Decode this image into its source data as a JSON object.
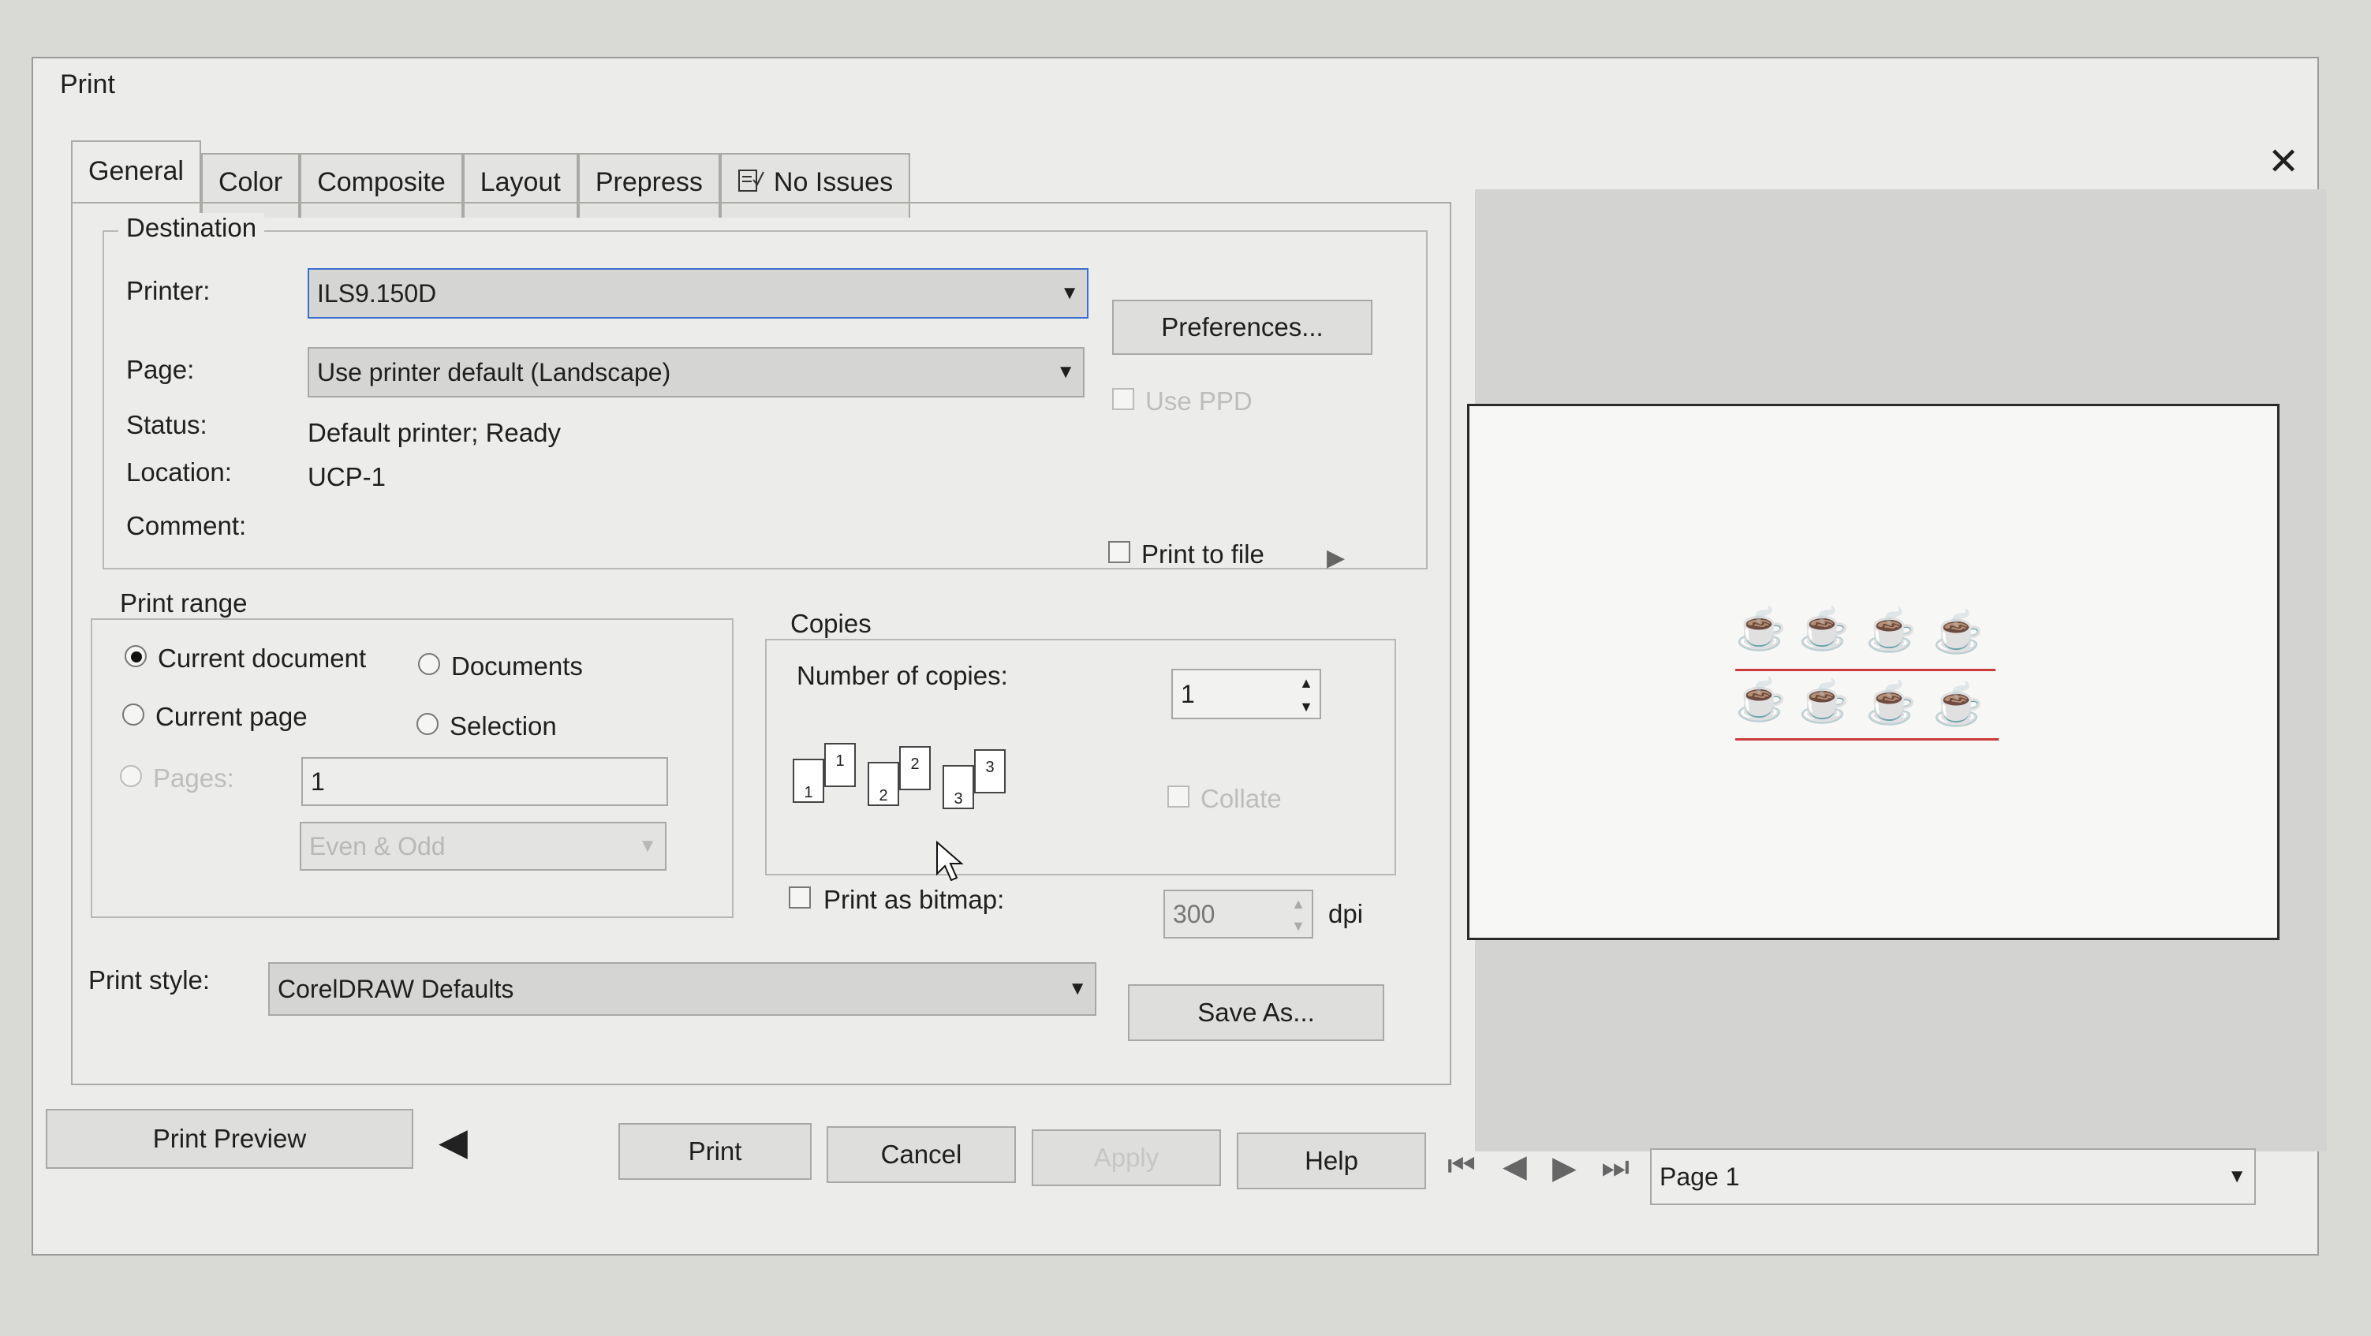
{
  "window": {
    "title": "Print"
  },
  "tabs": [
    {
      "label": "General",
      "active": true
    },
    {
      "label": "Color"
    },
    {
      "label": "Composite"
    },
    {
      "label": "Layout"
    },
    {
      "label": "Prepress"
    },
    {
      "label": "No Issues",
      "icon": "issues-icon"
    }
  ],
  "destination": {
    "legend": "Destination",
    "printer_label": "Printer:",
    "printer_value": "ILS9.150D",
    "preferences_button": "Preferences...",
    "page_label": "Page:",
    "page_value": "Use printer default (Landscape)",
    "use_ppd_label": "Use PPD",
    "status_label": "Status:",
    "status_value": "Default printer; Ready",
    "location_label": "Location:",
    "location_value": "UCP-1",
    "comment_label": "Comment:",
    "print_to_file_label": "Print to file"
  },
  "print_range": {
    "legend": "Print range",
    "current_document": "Current document",
    "documents": "Documents",
    "current_page": "Current page",
    "selection": "Selection",
    "pages_label": "Pages:",
    "pages_value": "1",
    "even_odd": "Even & Odd"
  },
  "copies": {
    "legend": "Copies",
    "number_label": "Number of copies:",
    "number_value": "1",
    "collate_label": "Collate",
    "collate_digits": [
      "1",
      "1",
      "2",
      "2",
      "3",
      "3"
    ]
  },
  "bitmap": {
    "label": "Print as bitmap:",
    "dpi_value": "300",
    "dpi_unit": "dpi"
  },
  "print_style": {
    "label": "Print style:",
    "value": "CorelDRAW Defaults",
    "save_as_button": "Save As..."
  },
  "footer": {
    "print_preview": "Print Preview",
    "print": "Print",
    "cancel": "Cancel",
    "apply": "Apply",
    "help": "Help",
    "page_select": "Page 1"
  },
  "colors": {
    "preview_art": "#cc3b3b",
    "focus_border": "#3a6fcf"
  }
}
